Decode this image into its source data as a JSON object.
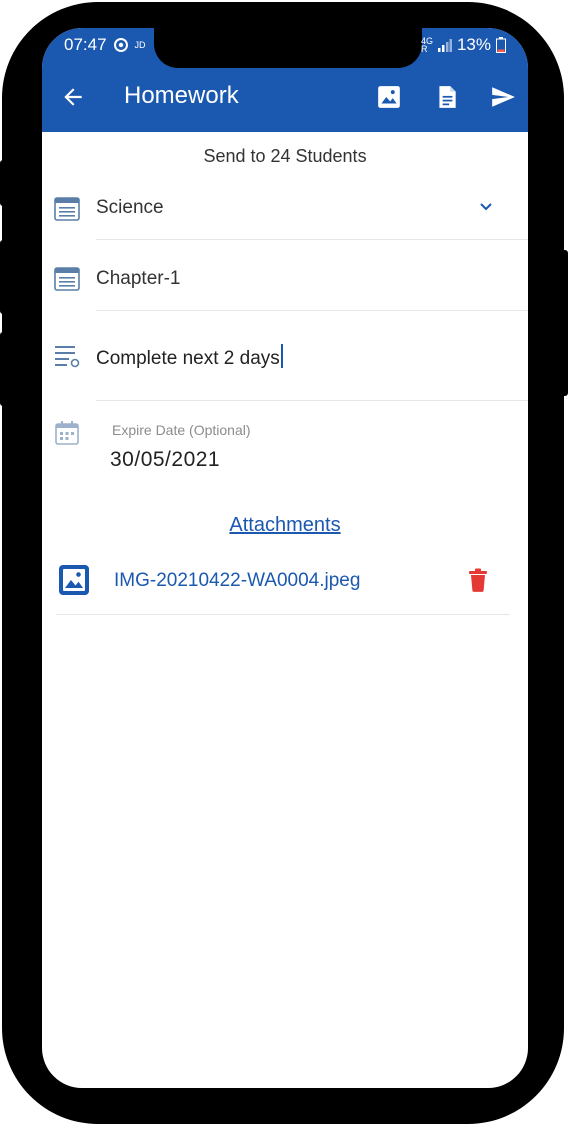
{
  "status_bar": {
    "time": "07:47",
    "left_small": "JD",
    "network_top": "4G",
    "network_bottom": "R",
    "battery": "13%"
  },
  "toolbar": {
    "title": "Homework",
    "back_icon": "arrow-left-icon",
    "image_icon": "image-icon",
    "document_icon": "document-icon",
    "send_icon": "send-icon"
  },
  "form": {
    "send_to": "Send to 24 Students",
    "subject": {
      "value": "Science",
      "icon": "book-list-icon"
    },
    "chapter": {
      "value": "Chapter-1",
      "icon": "book-list-icon"
    },
    "description": {
      "value": "Complete next 2 days",
      "icon": "notes-list-icon"
    },
    "expire": {
      "label": "Expire Date (Optional)",
      "value": "30/05/2021",
      "icon": "calendar-icon"
    }
  },
  "attachments": {
    "title": "Attachments",
    "items": [
      {
        "name": "IMG-20210422-WA0004.jpeg",
        "icon": "image-icon",
        "action_icon": "trash-icon"
      }
    ]
  },
  "colors": {
    "primary": "#1b58b0",
    "delete": "#e53935",
    "icon_muted": "#5b7ea8"
  }
}
